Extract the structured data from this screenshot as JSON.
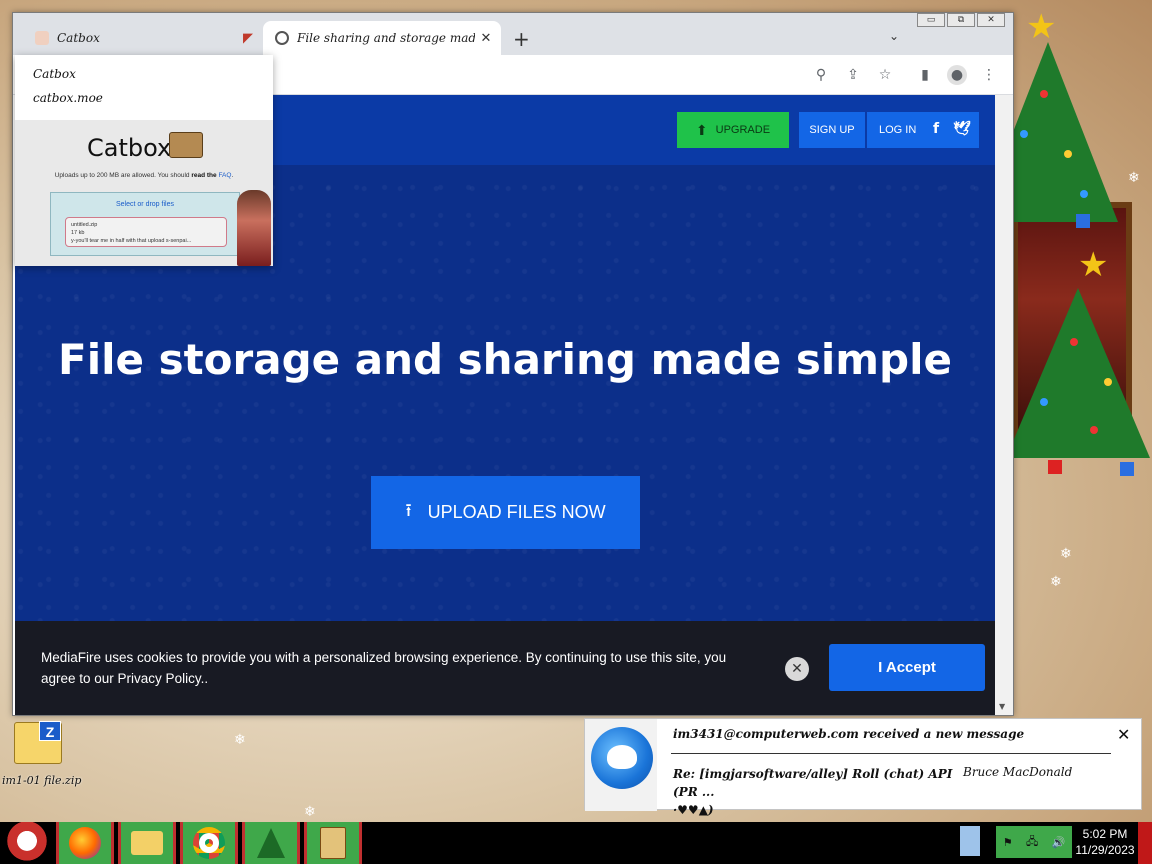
{
  "browser": {
    "tabs": [
      {
        "title": "Catbox",
        "active": false
      },
      {
        "title": "File sharing and storage made simple",
        "active": true
      }
    ],
    "new_tab_symbol": "+",
    "tab_search_symbol": "⌄",
    "window_controls": [
      "▭",
      "⧉",
      "✕"
    ],
    "toolbar_icons": [
      "search-icon",
      "share-icon",
      "star-icon",
      "sidepanel-icon",
      "profile-icon",
      "menu-icon"
    ]
  },
  "tab_preview": {
    "title": "Catbox",
    "domain": "catbox.moe",
    "thumb": {
      "logo": "Catbox",
      "note_prefix": "Uploads up to 200 MB are allowed. You should",
      "note_bold": "read the",
      "note_link": "FAQ",
      "drop_title": "Select or drop files",
      "file_name": "untitled.zip",
      "file_size": "17 kb",
      "file_caption": "y-you'll tear me in half with that upload s-senpai..."
    }
  },
  "mediafire": {
    "header": {
      "upgrade_label": "UPGRADE",
      "signup_label": "SIGN UP",
      "login_label": "LOG IN",
      "facebook": "f",
      "twitter": "🐦"
    },
    "hero_title": "File storage and sharing made simple",
    "upload_label": "UPLOAD FILES NOW",
    "cookie": {
      "text": "MediaFire uses cookies to provide you with a personalized browsing experience. By continuing to use this site, you agree to our Privacy Policy..",
      "close_symbol": "✕",
      "accept_label": "I Accept"
    }
  },
  "desktop_icon": {
    "label": "im1-01 file.zip"
  },
  "notification": {
    "from": "im3431@computerweb.com received a new message",
    "subject": "Re: [imgjarsoftware/alley] Roll (chat) API (PR ...",
    "subject_tail": "·♥♥▲)",
    "sender": "Bruce MacDonald",
    "close_symbol": "✕"
  },
  "taskbar": {
    "apps": [
      "firefox",
      "file-explorer",
      "chrome",
      "christmas-tree-app",
      "ning-po-app"
    ],
    "time": "5:02 PM",
    "date": "11/29/2023"
  },
  "colors": {
    "mediafire_blue": "#0b3aa6",
    "button_blue": "#1366e6",
    "upgrade_green": "#1fc24a",
    "cookie_bg": "#181a23"
  }
}
